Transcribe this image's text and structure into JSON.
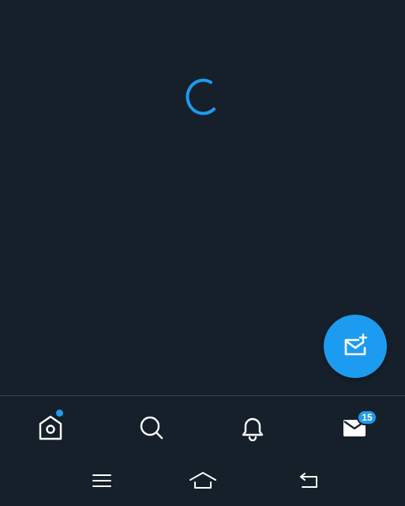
{
  "colors": {
    "background": "#15202b",
    "accent": "#1d9bf0",
    "icon": "#ffffff",
    "divider": "#38444d"
  },
  "loading": {
    "icon": "loading-spinner-icon"
  },
  "fab": {
    "icon": "new-message-icon"
  },
  "tabbar": {
    "tabs": [
      {
        "name": "home",
        "icon": "home-icon",
        "has_dot": true
      },
      {
        "name": "search",
        "icon": "search-icon"
      },
      {
        "name": "notifications",
        "icon": "bell-icon"
      },
      {
        "name": "messages",
        "icon": "mail-icon",
        "badge": "15"
      }
    ]
  },
  "system_nav": {
    "buttons": [
      {
        "icon": "recents-icon"
      },
      {
        "icon": "home-icon"
      },
      {
        "icon": "back-icon"
      }
    ]
  }
}
